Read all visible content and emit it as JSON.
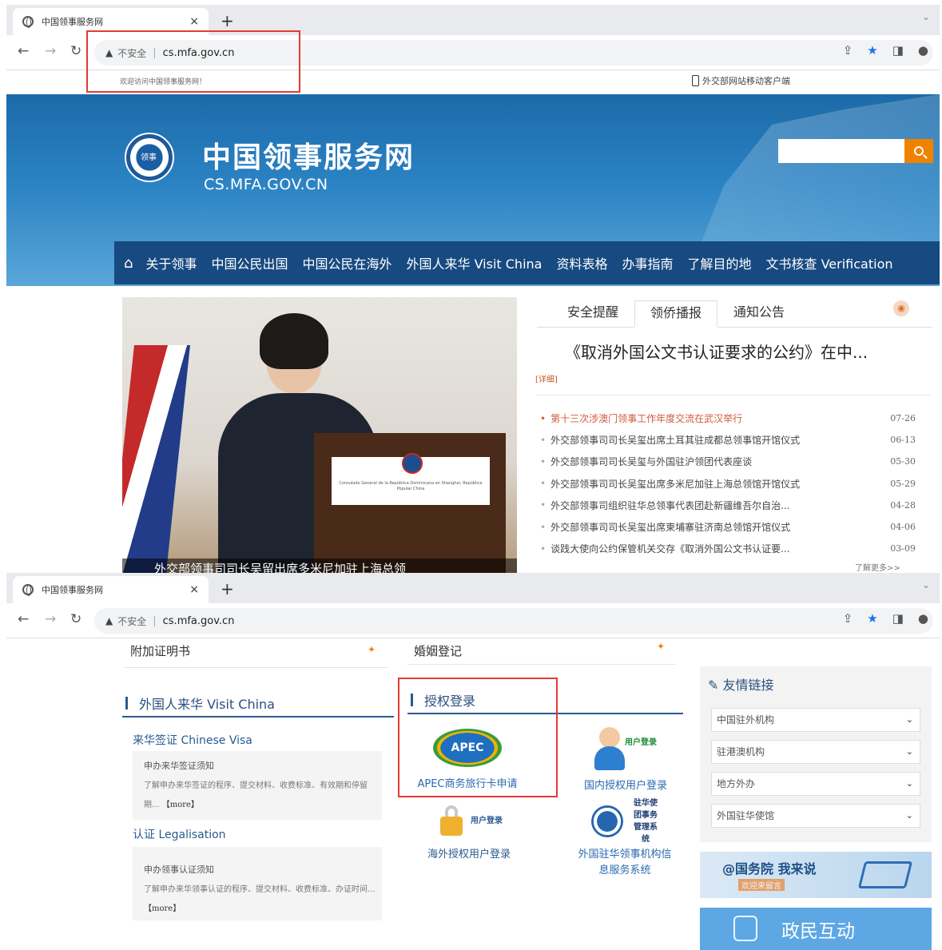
{
  "browser": {
    "tab_title": "中国领事服务网",
    "insecure_label": "不安全",
    "url": "cs.mfa.gov.cn"
  },
  "top_strip": {
    "welcome": "欢迎访问中国领事服务网！",
    "mobile_client": "外交部网站移动客户端"
  },
  "header": {
    "site_title": "中国领事服务网",
    "site_domain": "CS.MFA.GOV.CN"
  },
  "main_nav": [
    "关于领事",
    "中国公民出国",
    "中国公民在海外",
    "外国人来华 Visit China",
    "资料表格",
    "办事指南",
    "了解目的地",
    "文书核查 Verification"
  ],
  "feature": {
    "caption": "外交部领事司司长吴留出席多米尼加驻上海总领",
    "podium_sign": "Consulado General de la República Dominicana en Shanghai, República Popular China"
  },
  "news_tabs": [
    "安全提醒",
    "领侨播报",
    "通知公告"
  ],
  "headline": "《取消外国公文书认证要求的公约》在中...",
  "detail_label": "[详细]",
  "news": [
    {
      "title": "第十三次涉澳门领事工作年度交流在武汉举行",
      "date": "07-26"
    },
    {
      "title": "外交部领事司司长吴玺出席土耳其驻成都总领事馆开馆仪式",
      "date": "06-13"
    },
    {
      "title": "外交部领事司司长吴玺与外国驻沪领团代表座谈",
      "date": "05-30"
    },
    {
      "title": "外交部领事司司长吴玺出席多米尼加驻上海总领馆开馆仪式",
      "date": "05-29"
    },
    {
      "title": "外交部领事司组织驻华总领事代表团赴新疆维吾尔自治...",
      "date": "04-28"
    },
    {
      "title": "外交部领事司司长吴玺出席柬埔寨驻济南总领馆开馆仪式",
      "date": "04-06"
    },
    {
      "title": "谈践大使向公约保管机关交存《取消外国公文书认证要...",
      "date": "03-09"
    }
  ],
  "more_label": "了解更多>>",
  "lower": {
    "top_left_label": "附加证明书",
    "top_right_label": "婚姻登记",
    "visit_china_heading": "外国人来华 Visit China",
    "visa_link": "来华签证 Chinese Visa",
    "visa_box_title": "申办来华签证须知",
    "visa_box_text": "了解申办来华签证的程序、提交材料、收费标准、有效期和停留期...",
    "legal_link": "认证 Legalisation",
    "legal_box_title": "申办领事认证须知",
    "legal_box_text": "了解申办来华领事认证的程序、提交材料、收费标准、办证时间...",
    "more_tag": "【more】",
    "auth_heading": "授权登录",
    "apec_logo": "APEC",
    "apec_label": "APEC商务旅行卡申请",
    "domestic_label": "国内授权用户登录",
    "domestic_tag": "用户登录",
    "overseas_label": "海外授权用户登录",
    "overseas_tag": "用户登录",
    "foreign_label": "外国驻华领事机构信息服务系统",
    "foreign_tag": "驻华使团事务管理系统",
    "links_heading": "友情链接",
    "link_selects": [
      "中国驻外机构",
      "驻港澳机构",
      "地方外办",
      "外国驻华使馆"
    ],
    "gov_banner_title": "@国务院 我来说",
    "gov_banner_sub": "欢迎来留言",
    "interact_label": "政民互动"
  },
  "colors": {
    "nav_bg": "#174a80",
    "search_btn": "#f08200",
    "highlight": "#e53935",
    "link_blue": "#2a6ab0"
  }
}
